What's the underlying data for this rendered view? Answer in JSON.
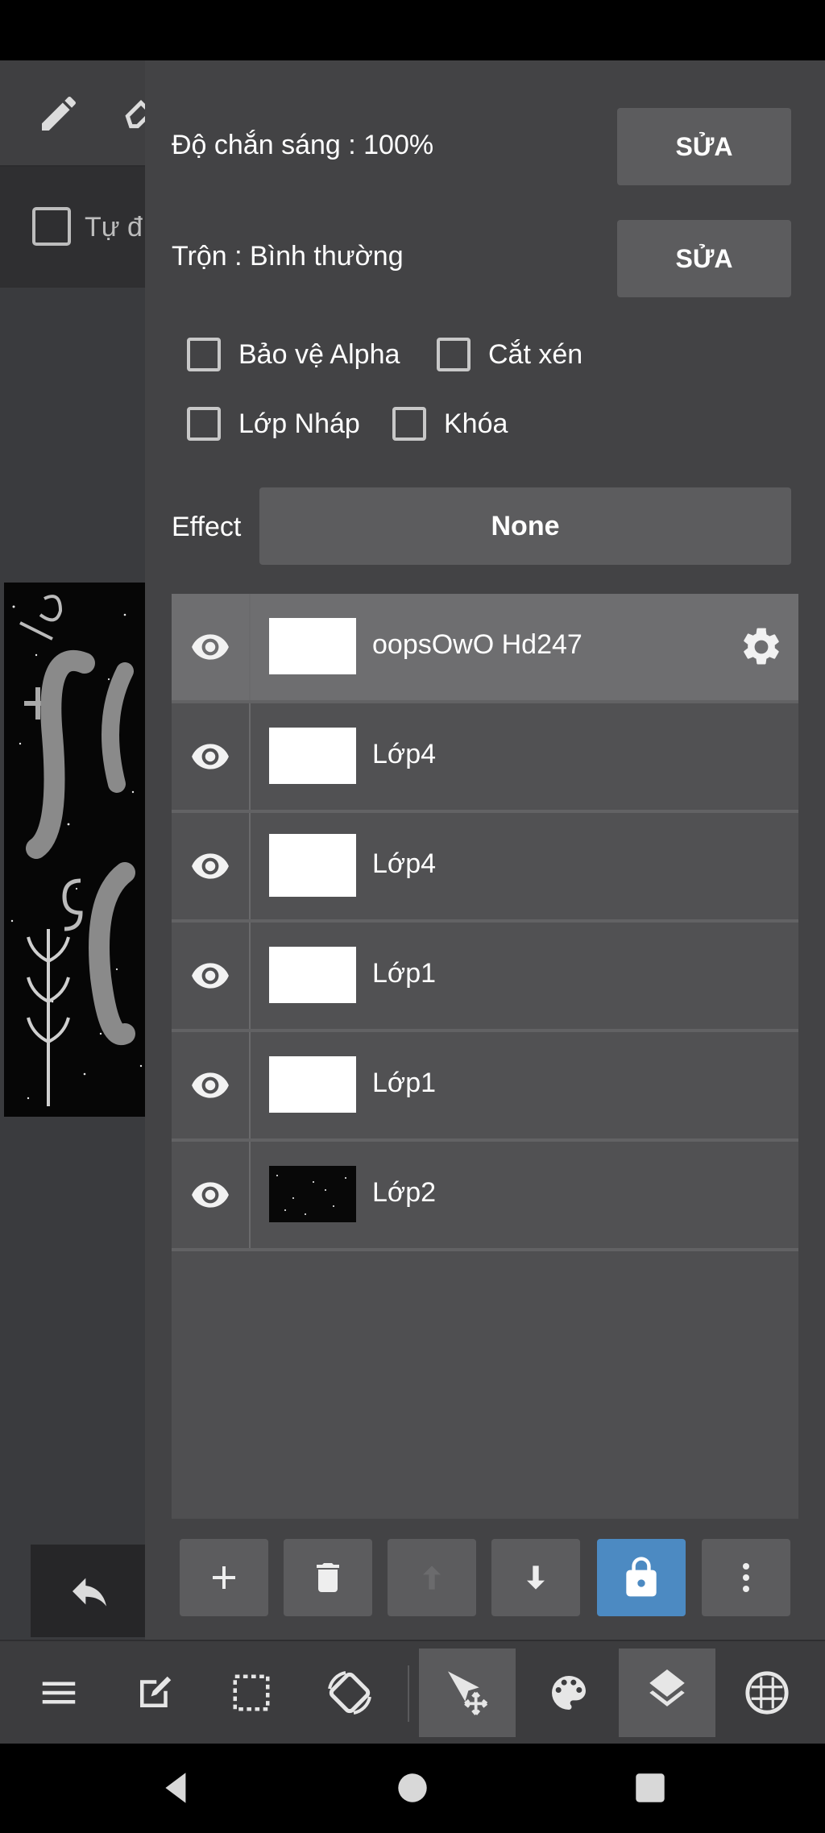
{
  "left_panel": {
    "auto_label": "Tự đ"
  },
  "properties": {
    "opacity_label": "Độ chắn sáng : 100%",
    "opacity_edit": "SỬA",
    "blend_label": "Trộn : Bình thường",
    "blend_edit": "SỬA",
    "checkboxes": [
      {
        "label": "Bảo vệ Alpha",
        "checked": false
      },
      {
        "label": "Cắt xén",
        "checked": false
      },
      {
        "label": "Lớp Nháp",
        "checked": false
      },
      {
        "label": "Khóa",
        "checked": false
      }
    ],
    "effect_label": "Effect",
    "effect_value": "None"
  },
  "layers": [
    {
      "name": "oopsOwO Hd247",
      "visible": true,
      "selected": true
    },
    {
      "name": "Lớp4",
      "visible": true,
      "selected": false
    },
    {
      "name": "Lớp4",
      "visible": true,
      "selected": false
    },
    {
      "name": "Lớp1",
      "visible": true,
      "selected": false
    },
    {
      "name": "Lớp1",
      "visible": true,
      "selected": false
    },
    {
      "name": "Lớp2",
      "visible": true,
      "selected": false
    }
  ],
  "colors": {
    "panel_bg": "#434345",
    "button_bg": "#5c5c5e",
    "accent_blue": "#4c8ac2",
    "selected_row": "#6e6e70"
  }
}
